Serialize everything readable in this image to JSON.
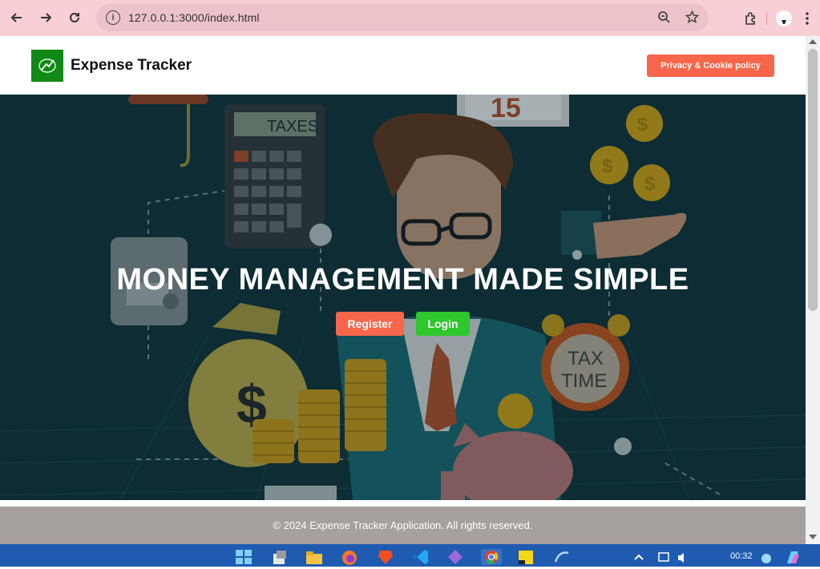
{
  "browser": {
    "url": "127.0.0.1:3000/index.html"
  },
  "header": {
    "brand": "Expense Tracker",
    "privacy_button": "Privacy & Cookie policy"
  },
  "hero": {
    "title": "MONEY MANAGEMENT MADE SIMPLE",
    "register_label": "Register",
    "login_label": "Login",
    "art_text": {
      "calculator": "TAXES",
      "calendar": "15",
      "clock_line1": "TAX",
      "clock_line2": "TIME"
    }
  },
  "footer": {
    "copyright": "© 2024 Expense Tracker Application. All rights reserved."
  },
  "taskbar": {
    "time": "00:32"
  },
  "colors": {
    "accent_orange": "#f7664a",
    "accent_green": "#2ec72e",
    "logo_green": "#0f8a16",
    "footer_gray": "#a6a09e",
    "chrome_pink": "#f7cfd4"
  }
}
